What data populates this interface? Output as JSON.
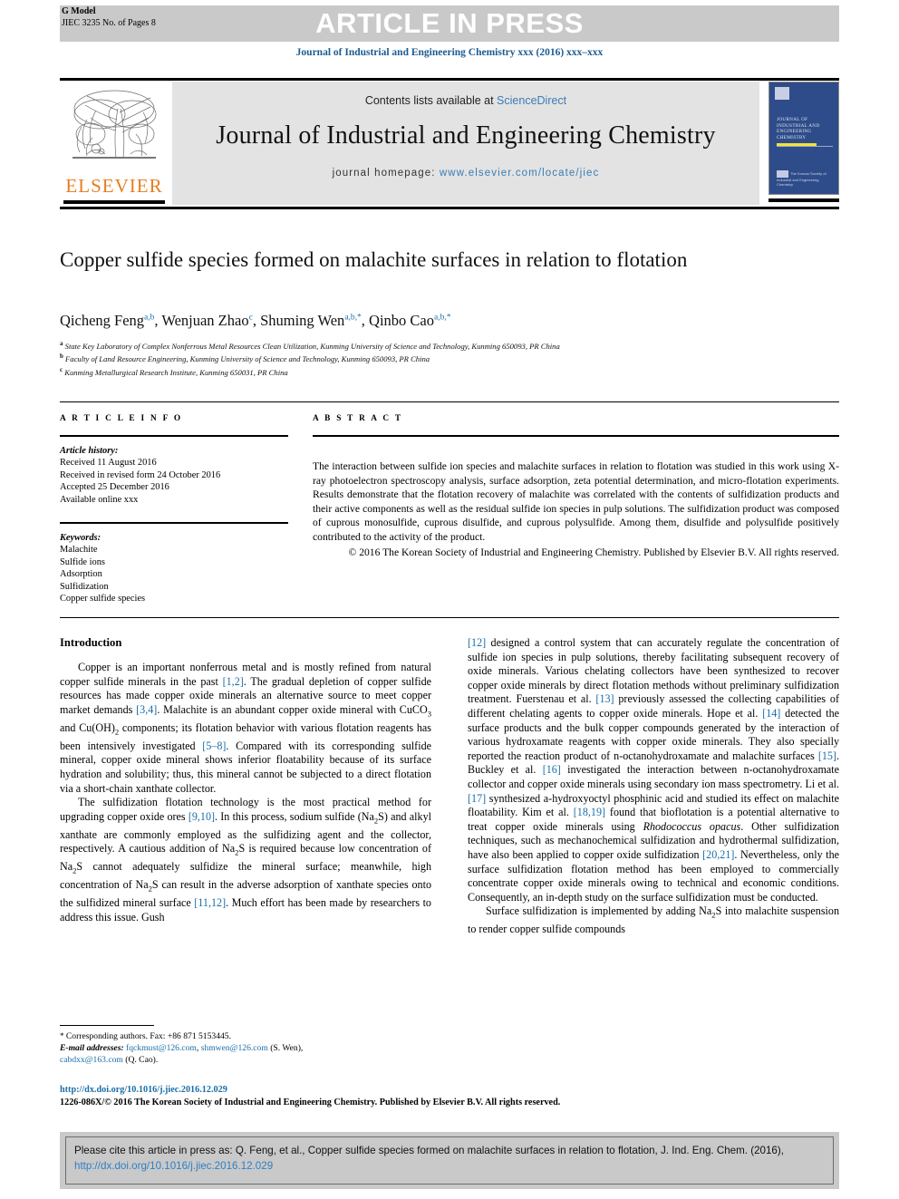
{
  "banner": {
    "press_label": "ARTICLE IN PRESS",
    "g_model_line1": "G Model",
    "g_model_line2": "JIEC 3235 No. of Pages 8"
  },
  "journal_line": "Journal of Industrial and Engineering Chemistry xxx (2016) xxx–xxx",
  "masthead": {
    "contents_prefix": "Contents lists available at ",
    "sciencedirect": "ScienceDirect",
    "journal_title": "Journal of Industrial and Engineering Chemistry",
    "homepage_prefix": "journal homepage: ",
    "homepage_url": "www.elsevier.com/locate/jiec",
    "publisher_logo_text": "ELSEVIER",
    "cover_title": "Journal of Industrial and Engineering Chemistry",
    "cover_footer": "The Korean Society of Industrial and Engineering Chemistry",
    "accent_blue": "#3b7cb5",
    "elsevier_orange": "#E87D1E",
    "cover_blue": "#2e4c8a"
  },
  "article": {
    "title": "Copper sulfide species formed on malachite surfaces in relation to flotation",
    "authors_html": "Qicheng Feng<sup>a,b</sup>, Wenjuan Zhao<sup>c</sup>, Shuming Wen<sup>a,b,*</sup>, Qinbo Cao<sup>a,b,*</sup>",
    "affiliations": [
      {
        "marker": "a",
        "text": "State Key Laboratory of Complex Nonferrous Metal Resources Clean Utilization, Kunming University of Science and Technology, Kunming 650093, PR China"
      },
      {
        "marker": "b",
        "text": "Faculty of Land Resource Engineering, Kunming University of Science and Technology, Kunming 650093, PR China"
      },
      {
        "marker": "c",
        "text": "Kunming Metallurgical Research Institute, Kunming 650031, PR China"
      }
    ]
  },
  "article_info": {
    "heading": "A R T I C L E   I N F O",
    "history_label": "Article history:",
    "history": [
      "Received 11 August 2016",
      "Received in revised form 24 October 2016",
      "Accepted 25 December 2016",
      "Available online xxx"
    ],
    "keywords_label": "Keywords:",
    "keywords": [
      "Malachite",
      "Sulfide ions",
      "Adsorption",
      "Sulfidization",
      "Copper sulfide species"
    ]
  },
  "abstract": {
    "heading": "A B S T R A C T",
    "body": "The interaction between sulfide ion species and malachite surfaces in relation to flotation was studied in this work using X-ray photoelectron spectroscopy analysis, surface adsorption, zeta potential determination, and micro-flotation experiments. Results demonstrate that the flotation recovery of malachite was correlated with the contents of sulfidization products and their active components as well as the residual sulfide ion species in pulp solutions. The sulfidization product was composed of cuprous monosulfide, cuprous disulfide, and cuprous polysulfide. Among them, disulfide and polysulfide positively contributed to the activity of the product.",
    "copyright": "© 2016 The Korean Society of Industrial and Engineering Chemistry. Published by Elsevier B.V. All rights reserved."
  },
  "body": {
    "intro_heading": "Introduction",
    "left_paragraphs": [
      "Copper is an important nonferrous metal and is mostly refined from natural copper sulfide minerals in the past [1,2]. The gradual depletion of copper sulfide resources has made copper oxide minerals an alternative source to meet copper market demands [3,4]. Malachite is an abundant copper oxide mineral with CuCO3 and Cu(OH)2 components; its flotation behavior with various flotation reagents has been intensively investigated [5–8]. Compared with its corresponding sulfide mineral, copper oxide mineral shows inferior floatability because of its surface hydration and solubility; thus, this mineral cannot be subjected to a direct flotation via a short-chain xanthate collector.",
      "The sulfidization flotation technology is the most practical method for upgrading copper oxide ores [9,10]. In this process, sodium sulfide (Na2S) and alkyl xanthate are commonly employed as the sulfidizing agent and the collector, respectively. A cautious addition of Na2S is required because low concentration of Na2S cannot adequately sulfidize the mineral surface; meanwhile, high concentration of Na2S can result in the adverse adsorption of xanthate species onto the sulfidized mineral surface [11,12]. Much effort has been made by researchers to address this issue. Gush"
    ],
    "right_paragraphs": [
      "[12] designed a control system that can accurately regulate the concentration of sulfide ion species in pulp solutions, thereby facilitating subsequent recovery of oxide minerals. Various chelating collectors have been synthesized to recover copper oxide minerals by direct flotation methods without preliminary sulfidization treatment. Fuerstenau et al. [13] previously assessed the collecting capabilities of different chelating agents to copper oxide minerals. Hope et al. [14] detected the surface products and the bulk copper compounds generated by the interaction of various hydroxamate reagents with copper oxide minerals. They also specially reported the reaction product of n-octanohydroxamate and malachite surfaces [15]. Buckley et al. [16] investigated the interaction between n-octanohydroxamate collector and copper oxide minerals using secondary ion mass spectrometry. Li et al. [17] synthesized a-hydroxyoctyl phosphinic acid and studied its effect on malachite floatability. Kim et al. [18,19] found that bioflotation is a potential alternative to treat copper oxide minerals using Rhodococcus opacus. Other sulfidization techniques, such as mechanochemical sulfidization and hydrothermal sulfidization, have also been applied to copper oxide sulfidization [20,21]. Nevertheless, only the surface sulfidization flotation method has been employed to commercially concentrate copper oxide minerals owing to technical and economic conditions. Consequently, an in-depth study on the surface sulfidization must be conducted.",
      "Surface sulfidization is implemented by adding Na2S into malachite suspension to render copper sulfide compounds"
    ]
  },
  "footnotes": {
    "corresponding": "Corresponding authors. Fax: +86 871 5153445.",
    "email_label": "E-mail addresses:",
    "email1": "fqckmust@126.com",
    "email2": "shmwen@126.com",
    "email_affil1": "(S. Wen),",
    "email3": "cabdxx@163.com",
    "email_affil2": "(Q. Cao)."
  },
  "doi_block": {
    "doi_url": "http://dx.doi.org/10.1016/j.jiec.2016.12.029",
    "issn_line": "1226-086X/© 2016 The Korean Society of Industrial and Engineering Chemistry. Published by Elsevier B.V. All rights reserved."
  },
  "cite_box": {
    "text_part1": "Please cite this article in press as: Q. Feng, et al., Copper sulfide species formed on malachite surfaces in relation to flotation, J. Ind. Eng. Chem. (2016), ",
    "link": "http://dx.doi.org/10.1016/j.jiec.2016.12.029"
  }
}
